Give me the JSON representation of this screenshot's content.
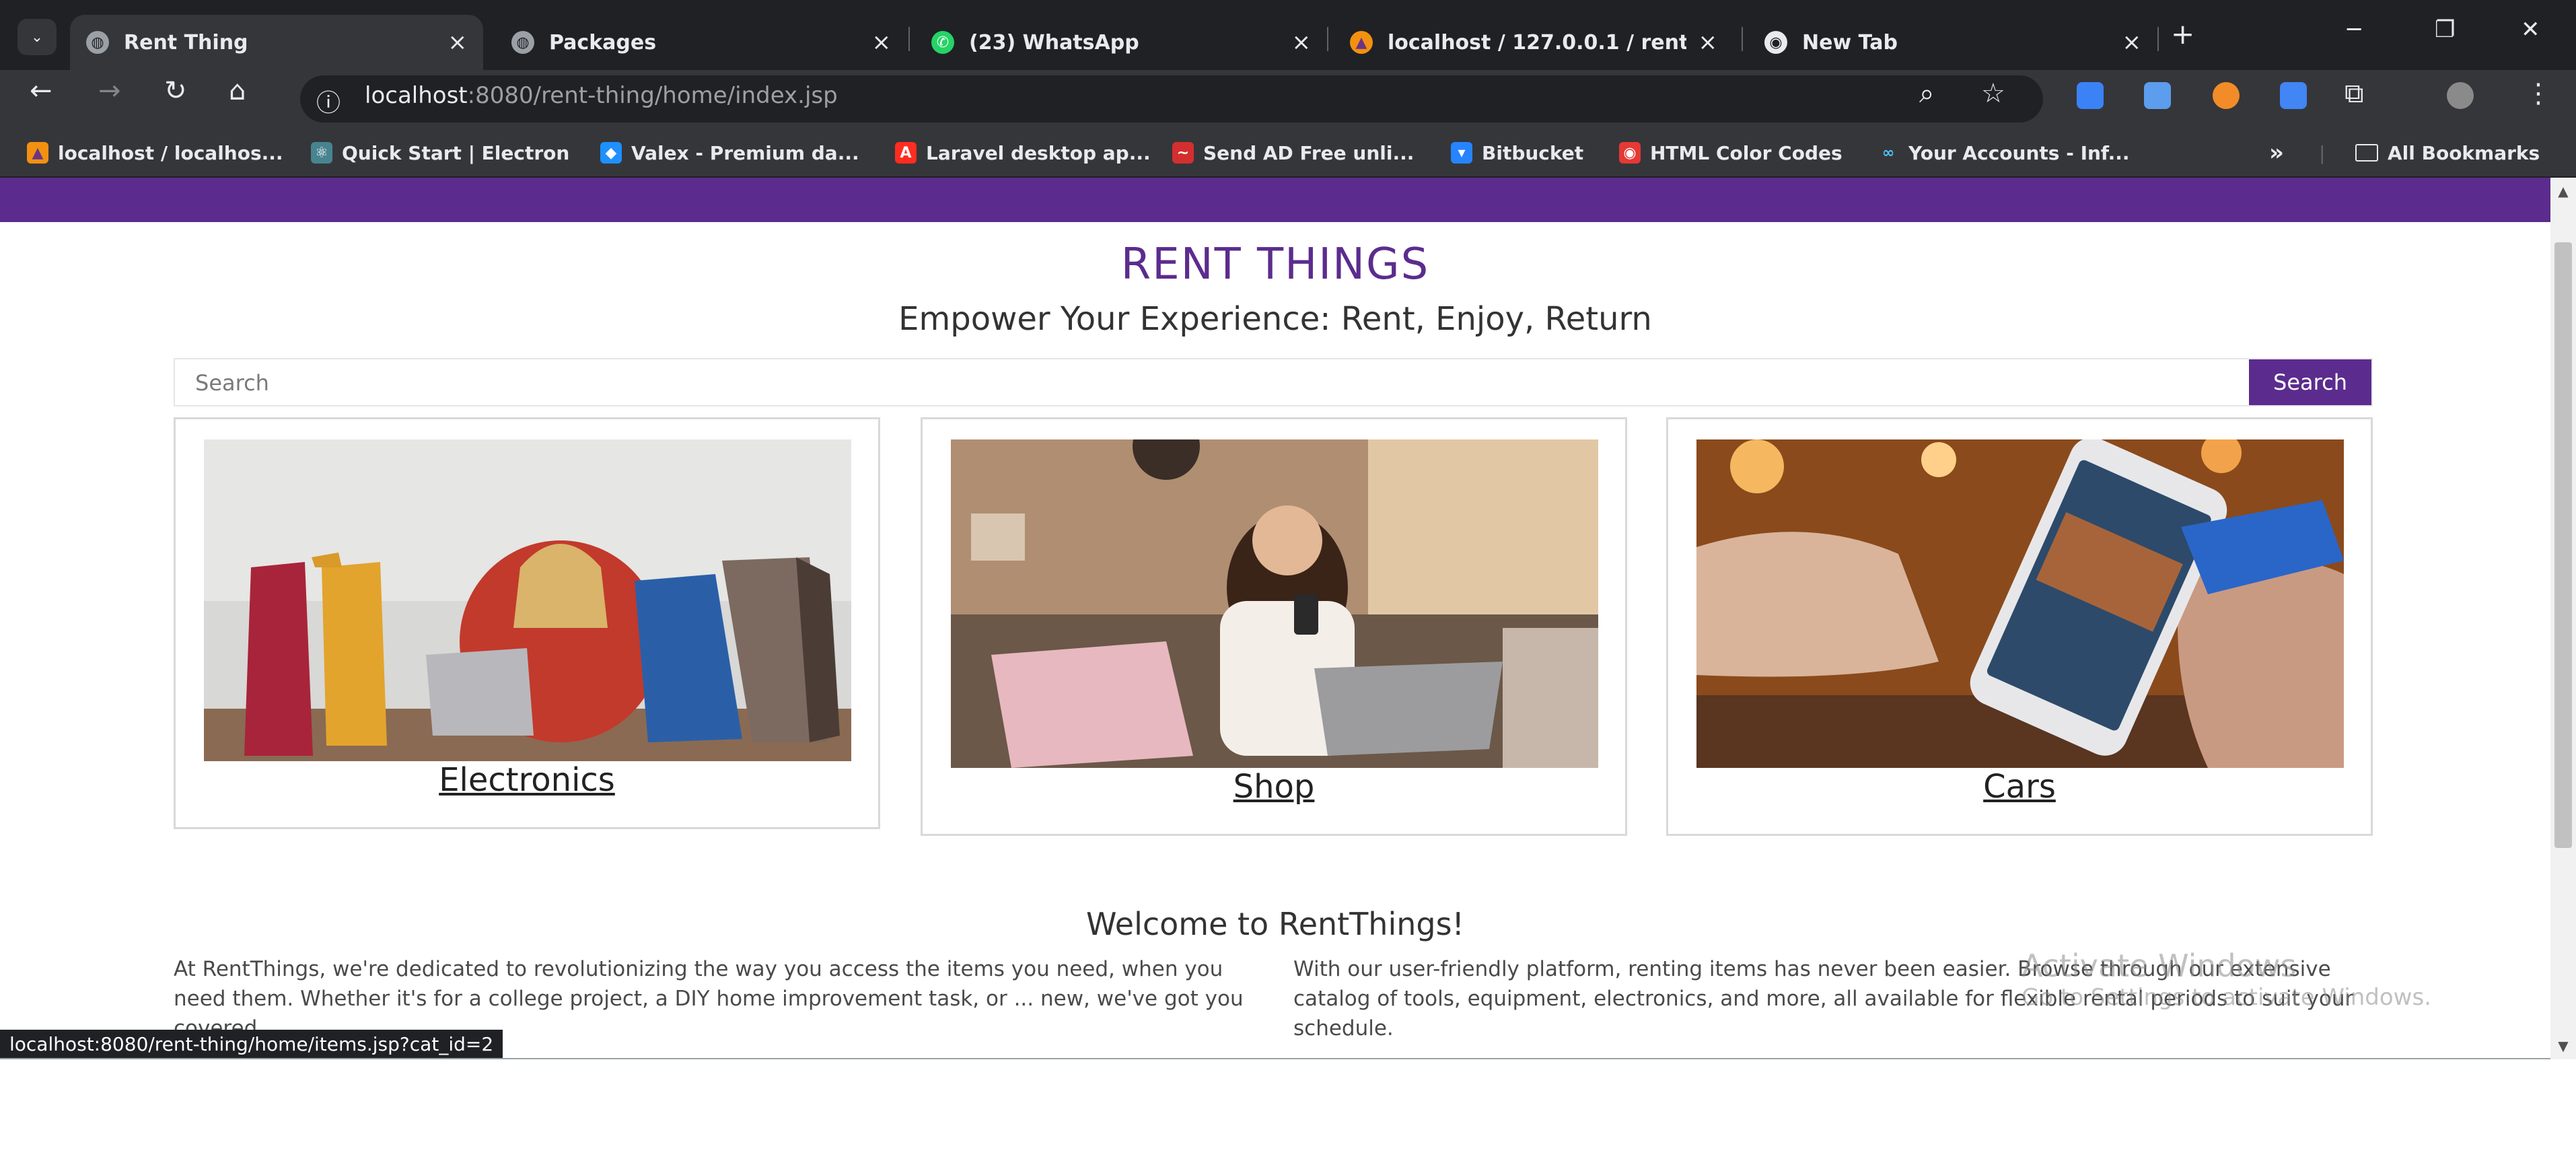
{
  "browser": {
    "tabs": [
      {
        "label": "Rent Thing",
        "active": true
      },
      {
        "label": "Packages",
        "active": false
      },
      {
        "label": "(23) WhatsApp",
        "active": false
      },
      {
        "label": "localhost / 127.0.0.1 / rent_t",
        "active": false
      },
      {
        "label": "New Tab",
        "active": false
      }
    ],
    "address": {
      "host": "localhost",
      "rest": ":8080/rent-thing/home/index.jsp"
    },
    "bookmarks": [
      "localhost / localhos...",
      "Quick Start | Electron",
      "Valex - Premium da...",
      "Laravel desktop ap...",
      "Send AD Free unli...",
      "Bitbucket",
      "HTML Color Codes",
      "Your Accounts - Inf..."
    ],
    "bookmarks_more": "»",
    "all_bookmarks": "All Bookmarks",
    "colors": {
      "frame": "#202124",
      "toolbar": "#35363a"
    }
  },
  "site": {
    "title": "RENT THINGS",
    "tagline": "Empower Your Experience: Rent, Enjoy, Return",
    "search": {
      "placeholder": "Search",
      "button": "Search"
    },
    "categories": [
      {
        "label": "Electronics",
        "image": "woman-laptop-shopping-bags-photo"
      },
      {
        "label": "Shop",
        "image": "woman-phone-sofa-photo"
      },
      {
        "label": "Cars",
        "image": "hand-phone-credit-card-photo"
      }
    ],
    "welcome": "Welcome to RentThings!",
    "intro_left": "At RentThings, we're dedicated to revolutionizing the way you access the items you need, when you need them. Whether it's for a college project, a DIY home improvement task, or ... new, we've got you covered.",
    "intro_right": "With our user-friendly platform, renting items has never been easier. Browse through our extensive catalog of tools, equipment, electronics, and more, all available for flexible rental periods to suit your schedule.",
    "colors": {
      "brand": "#5b2c8e"
    }
  },
  "os": {
    "watermark_title": "Activate Windows",
    "watermark_sub": "Go to Settings to activate Windows."
  },
  "status_url": "localhost:8080/rent-thing/home/items.jsp?cat_id=2"
}
